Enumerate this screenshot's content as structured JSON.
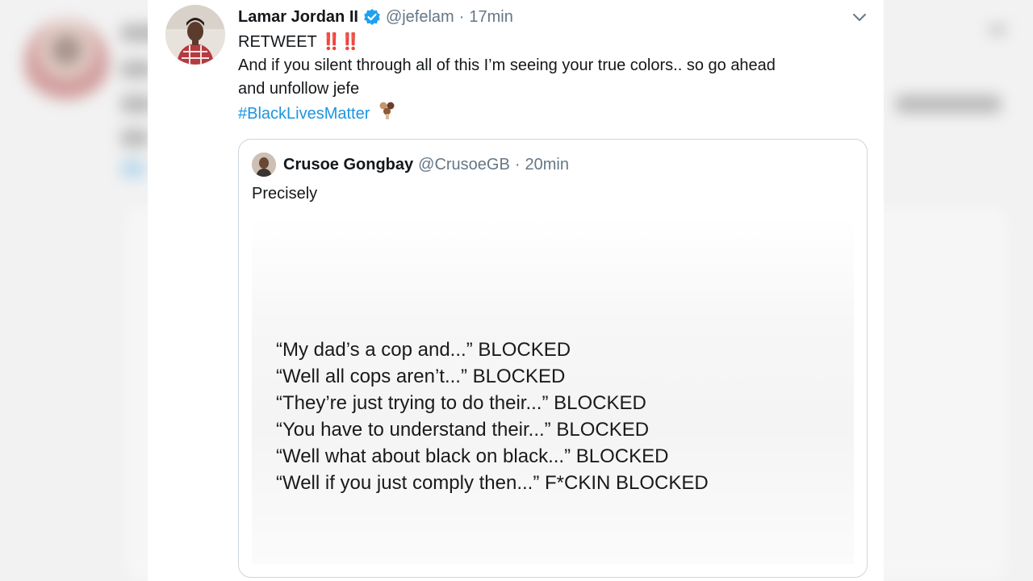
{
  "tweet": {
    "author": "Lamar Jordan II",
    "handle": "@jefelam",
    "time": "17min",
    "separator": "·",
    "line1": "RETWEET",
    "line1_emoji": "‼️‼️",
    "line2": "And if you silent through all of this I’m seeing your true colors.. so go ahead",
    "line3": "and unfollow jefe",
    "hashtag": "#BlackLivesMatter"
  },
  "quoted": {
    "author": "Crusoe Gongbay",
    "handle": "@CrusoeGB",
    "time": "20min",
    "separator": "·",
    "text": "Precisely",
    "image_lines": [
      "“My dad’s a cop and...” BLOCKED",
      "“Well all cops aren’t...” BLOCKED",
      "“They’re just trying to do their...” BLOCKED",
      "“You have to understand their...” BLOCKED",
      "“Well what about black on black...” BLOCKED",
      "“Well if you just comply then...” F*CKIN BLOCKED"
    ]
  },
  "colors": {
    "link": "#1b95e0",
    "verified": "#1da1f2",
    "muted": "#657786"
  },
  "icons": {
    "verified": "verified-badge-icon",
    "menu": "chevron-down-icon",
    "emoji": "raised-fist-emoji-icon"
  }
}
